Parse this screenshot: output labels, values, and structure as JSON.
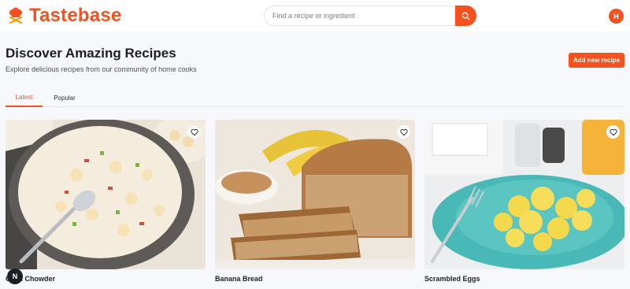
{
  "app": {
    "name": "Tastebase",
    "logo_icon": "chef-hat-icon",
    "brand_color": "#f4511e"
  },
  "search": {
    "placeholder": "Find a recipe or ingredient",
    "icon": "search-icon"
  },
  "user": {
    "initial": "H"
  },
  "page": {
    "title": "Discover Amazing Recipes",
    "subtitle": "Explore delicious recipes from our community of home cooks",
    "add_button": "Add new recipe"
  },
  "tabs": [
    {
      "label": "Latest",
      "active": true
    },
    {
      "label": "Popular",
      "active": false
    }
  ],
  "recipes": [
    {
      "title": "Clam Chowder",
      "favorite_icon": "heart-icon"
    },
    {
      "title": "Banana Bread",
      "favorite_icon": "heart-icon"
    },
    {
      "title": "Scrambled Eggs",
      "favorite_icon": "heart-icon"
    }
  ],
  "floating_badge": {
    "letter": "N"
  }
}
